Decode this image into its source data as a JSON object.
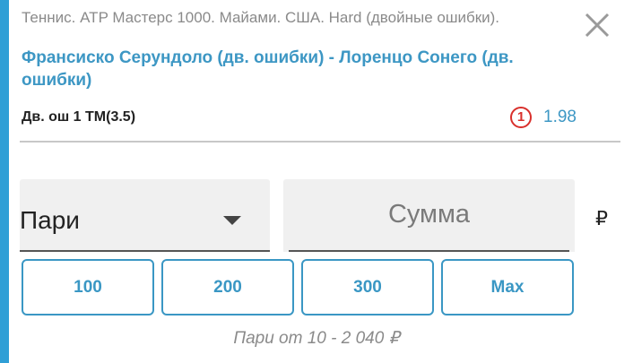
{
  "colors": {
    "accent": "#2f9fd6",
    "link": "#3d97c4",
    "alert": "#d9302c"
  },
  "header": {
    "sport_line": "Теннис. ATP Мастерс 1000. Майами. США. Hard (двойные ошибки).",
    "close_icon": "close-icon"
  },
  "event": {
    "title": "Франсиско Серундоло (дв. ошибки) - Лоренцо Сонего (дв. ошибки)"
  },
  "selection": {
    "market": "Дв. ош 1 ТМ(3.5)",
    "change_badge": "1",
    "odds": "1.98"
  },
  "bet_form": {
    "type": "Пари",
    "amount_value": "",
    "amount_placeholder": "Сумма",
    "currency": "₽",
    "quick_amounts": [
      "100",
      "200",
      "300",
      "Max"
    ],
    "limits": "Пари от 10 - 2 040 ₽"
  }
}
